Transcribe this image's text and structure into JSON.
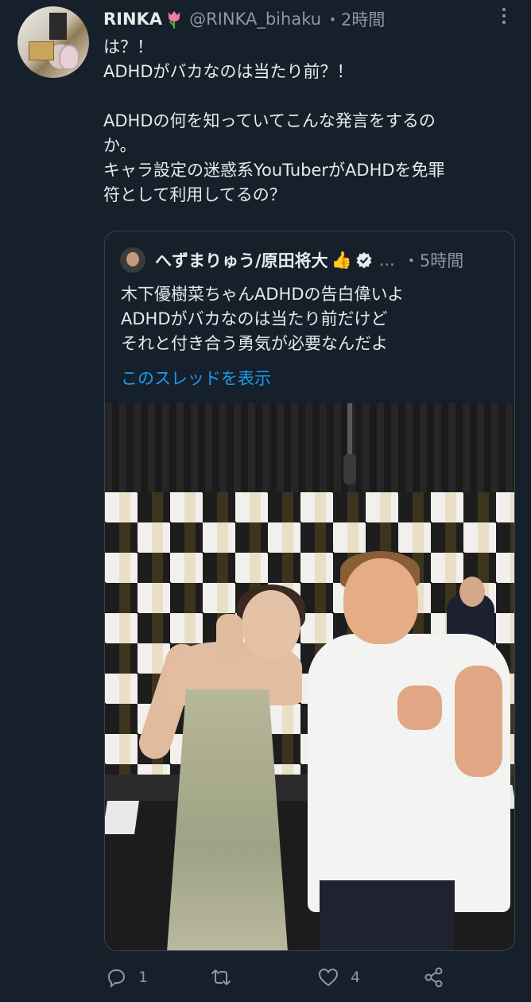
{
  "tweet": {
    "author": {
      "name": "RINKA",
      "name_emoji": "tulip",
      "handle": "@RINKA_bihaku",
      "time": "・2時間"
    },
    "menu_icon": "more-vertical-icon",
    "body": [
      "は？！",
      "ADHDがバカなのは当たり前？！",
      "",
      "ADHDの何を知っていてこんな発言をするの",
      "か。",
      "キャラ設定の迷惑系YouTuberがADHDを免罪",
      "符として利用してるの？"
    ],
    "quoted": {
      "name": "へずまりゅう/原田将大",
      "name_emoji": "👍",
      "verified": true,
      "ellipsis": "...",
      "time": "・5時間",
      "body": [
        "木下優樹菜ちゃんADHDの告白偉いよ",
        "ADHDがバカなのは当たり前だけど",
        "それと付き合う勇気が必要なんだよ"
      ],
      "thread_link": "このスレッドを表示",
      "media": "photo"
    },
    "actions": {
      "reply_count": "1",
      "like_count": "4"
    },
    "colors": {
      "background": "#15202b",
      "text": "#e7e9ea",
      "muted": "#8b98a5",
      "link": "#1d9bf0",
      "border": "#38444d"
    }
  }
}
